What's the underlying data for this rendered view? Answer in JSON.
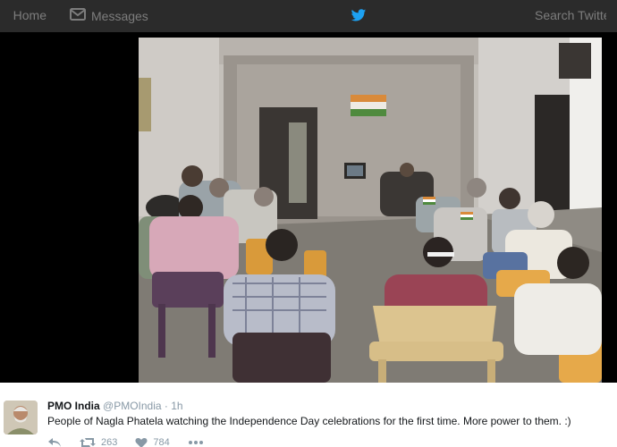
{
  "nav": {
    "home_label": "Home",
    "messages_label": "Messages",
    "right_label": "Search Twitter"
  },
  "tweet": {
    "author_name": "PMO India",
    "author_handle": "@PMOIndia",
    "separator": "·",
    "timestamp": "1h",
    "text": "People of Nagla Phatela watching the Independence Day celebrations for the first time. More power to them. :)",
    "retweet_count": "263",
    "like_count": "784"
  },
  "colors": {
    "nav_background": "#2b2b2b",
    "twitter_blue": "#1da1f2",
    "muted_text": "#8899a6"
  },
  "icons": [
    "messages-icon",
    "twitter-bird-icon",
    "reply-icon",
    "retweet-icon",
    "like-icon",
    "more-icon"
  ]
}
